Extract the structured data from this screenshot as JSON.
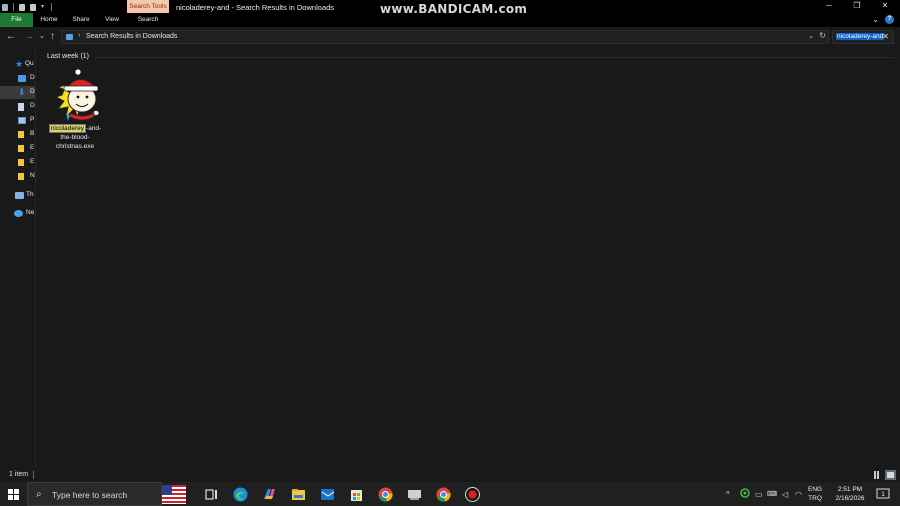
{
  "window": {
    "title": "nicoladerey-and - Search Results in Downloads",
    "context_tab": "Search Tools",
    "watermark": "www.BANDICAM.com",
    "controls": {
      "minimize": "─",
      "maximize": "❐",
      "close": "✕"
    }
  },
  "ribbon": {
    "tabs": [
      "File",
      "Home",
      "Share",
      "View",
      "Search"
    ],
    "help": "?"
  },
  "address": {
    "path": "Search Results in Downloads",
    "search_value": "nicoladerey-and",
    "search_clear": "✕"
  },
  "nav_pane": {
    "items": [
      {
        "label": "Qu",
        "icon": "star-icon",
        "color": "#3b8ae6"
      },
      {
        "label": "D",
        "icon": "desktop-folder-icon",
        "color": "#4a9be8"
      },
      {
        "label": "D",
        "icon": "downloads-icon",
        "color": "#3b8ae6",
        "selected": true
      },
      {
        "label": "D",
        "icon": "documents-icon",
        "color": "#c9d7ea"
      },
      {
        "label": "P",
        "icon": "pictures-icon",
        "color": "#9fc7ef"
      },
      {
        "label": "B",
        "icon": "folder-icon",
        "color": "#f4c542"
      },
      {
        "label": "E",
        "icon": "folder-icon",
        "color": "#f4c542"
      },
      {
        "label": "E",
        "icon": "folder-icon",
        "color": "#f4c542"
      },
      {
        "label": "N",
        "icon": "folder-icon",
        "color": "#f4c542"
      },
      {
        "label": "Th",
        "icon": "this-pc-icon",
        "color": "#7fb2e6"
      },
      {
        "label": "Ne",
        "icon": "network-icon",
        "color": "#4ba3e8"
      }
    ]
  },
  "content": {
    "group_header": "Last week (1)",
    "file": {
      "name_highlight": "nicoladerey",
      "name_line1_rest": "-and-",
      "name_line2": "the-blood-",
      "name_line3": "christnas.exe"
    }
  },
  "status": {
    "item_count": "1 item"
  },
  "taskbar": {
    "search_placeholder": "Type here to search",
    "time": "2:51 PM",
    "date": "2/16/2026",
    "lang_line1": "ENG",
    "lang_line2": "TRQ",
    "notification_count": "1"
  }
}
